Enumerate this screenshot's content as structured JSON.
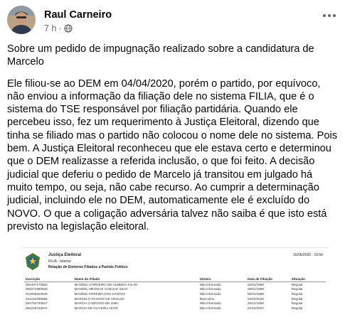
{
  "post": {
    "author": "Raul Carneiro",
    "time": "7 h",
    "separator": "·",
    "privacy_icon": "globe-icon",
    "more_icon": "more-options-icon",
    "paragraphs": [
      "Sobre um pedido de impugnação realizado sobre a candidatura de Marcelo",
      "Ele filiou-se ao DEM em 04/04/2020, porém o partido, por equívoco, não enviou a informação da filiação dele no sistema FILIA, que é o sistema do TSE responsável por filiação partidária. Quando ele percebeu isso, fez um requerimento à Justiça Eleitoral, dizendo que tinha se filiado mas o partido não colocou o nome dele no sistema. Pois bem. A Justiça Eleitoral reconheceu que ele estava certo e determinou que o DEM realizasse a referida inclusão, o que foi feito. A decisão judicial que deferiu o pedido de Marcelo já transitou em julgado há muito tempo, ou seja, não cabe recurso. Ao cumprir a determinação judicial, incluindo ele no DEM, automaticamente ele é excluído do NOVO. O que a coligação adversária talvez não saiba é que isto está previsto na legislação eleitoral."
    ]
  },
  "document": {
    "org": "Justiça Eleitoral",
    "system": "FILIA - Interno",
    "report": "Relação de Eleitores Filiados a Partido Político",
    "date": "16/06/2020 - 15:56",
    "columns": [
      "Inscrição",
      "Nome do Filiado",
      "Gênero",
      "Data de Filiação",
      "Situação"
    ],
    "rows": [
      [
        "002497170582",
        "MANOEL CORDEIRO DE ALMEIDA FILHO",
        "Não informado",
        "02/04/1990",
        "Regular"
      ],
      [
        "008371880558",
        "MANOEL MESSIAS COELHO SILVA",
        "Não informado",
        "09/01/1986",
        "Regular"
      ],
      [
        "014060620549",
        "MANOEL PEREIRA DOS SANTOS",
        "Não informado",
        "05/01/1988",
        "Regular"
      ],
      [
        "041232290688",
        "MARCELO PASSOS DE ARAÚJO",
        "Masculino",
        "04/04/2020",
        "Regular"
      ],
      [
        "054754740527",
        "MARCIA CARDOSO DE LIMA",
        "Não informado",
        "29/12/1995",
        "Regular"
      ],
      [
        "054248730574",
        "MARCIA DE OLIVEIRA LEITE",
        "Não informado",
        "01/10/2007",
        "Regular"
      ]
    ]
  }
}
